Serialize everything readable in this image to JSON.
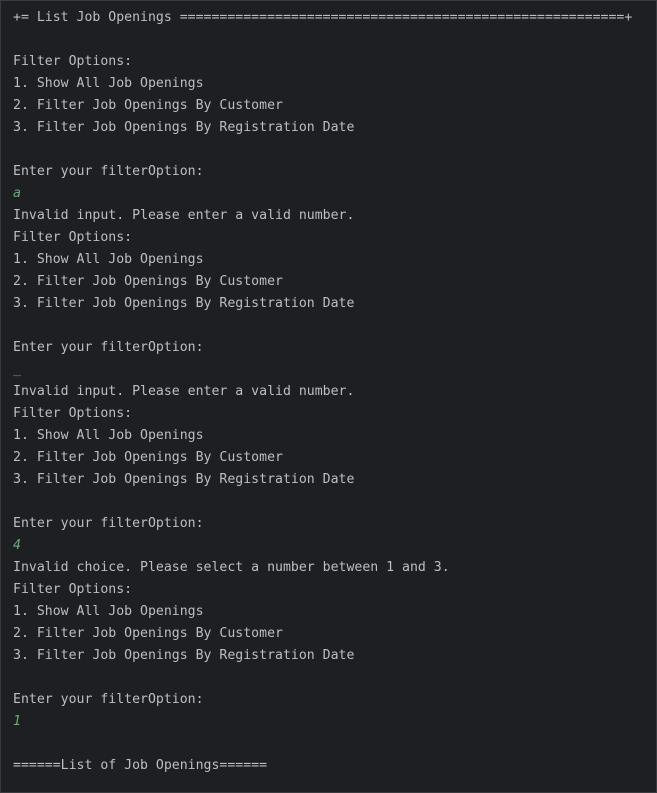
{
  "console": {
    "lines": [
      {
        "kind": "output",
        "text": "+= List Job Openings ========================================================+"
      },
      {
        "kind": "output",
        "text": ""
      },
      {
        "kind": "output",
        "text": "Filter Options:"
      },
      {
        "kind": "output",
        "text": "1. Show All Job Openings"
      },
      {
        "kind": "output",
        "text": "2. Filter Job Openings By Customer"
      },
      {
        "kind": "output",
        "text": "3. Filter Job Openings By Registration Date"
      },
      {
        "kind": "output",
        "text": ""
      },
      {
        "kind": "output",
        "text": "Enter your filterOption:"
      },
      {
        "kind": "input",
        "text": "a"
      },
      {
        "kind": "output",
        "text": "Invalid input. Please enter a valid number."
      },
      {
        "kind": "output",
        "text": "Filter Options:"
      },
      {
        "kind": "output",
        "text": "1. Show All Job Openings"
      },
      {
        "kind": "output",
        "text": "2. Filter Job Openings By Customer"
      },
      {
        "kind": "output",
        "text": "3. Filter Job Openings By Registration Date"
      },
      {
        "kind": "output",
        "text": ""
      },
      {
        "kind": "output",
        "text": "Enter your filterOption:"
      },
      {
        "kind": "input",
        "text": "_"
      },
      {
        "kind": "output",
        "text": "Invalid input. Please enter a valid number."
      },
      {
        "kind": "output",
        "text": "Filter Options:"
      },
      {
        "kind": "output",
        "text": "1. Show All Job Openings"
      },
      {
        "kind": "output",
        "text": "2. Filter Job Openings By Customer"
      },
      {
        "kind": "output",
        "text": "3. Filter Job Openings By Registration Date"
      },
      {
        "kind": "output",
        "text": ""
      },
      {
        "kind": "output",
        "text": "Enter your filterOption:"
      },
      {
        "kind": "input",
        "text": "4"
      },
      {
        "kind": "output",
        "text": "Invalid choice. Please select a number between 1 and 3."
      },
      {
        "kind": "output",
        "text": "Filter Options:"
      },
      {
        "kind": "output",
        "text": "1. Show All Job Openings"
      },
      {
        "kind": "output",
        "text": "2. Filter Job Openings By Customer"
      },
      {
        "kind": "output",
        "text": "3. Filter Job Openings By Registration Date"
      },
      {
        "kind": "output",
        "text": ""
      },
      {
        "kind": "output",
        "text": "Enter your filterOption:"
      },
      {
        "kind": "input",
        "text": "1"
      },
      {
        "kind": "output",
        "text": ""
      },
      {
        "kind": "output",
        "text": "======List of Job Openings======"
      }
    ]
  },
  "colors": {
    "background": "#1e1f22",
    "output_text": "#bcbec4",
    "user_input_text": "#6aab73"
  }
}
